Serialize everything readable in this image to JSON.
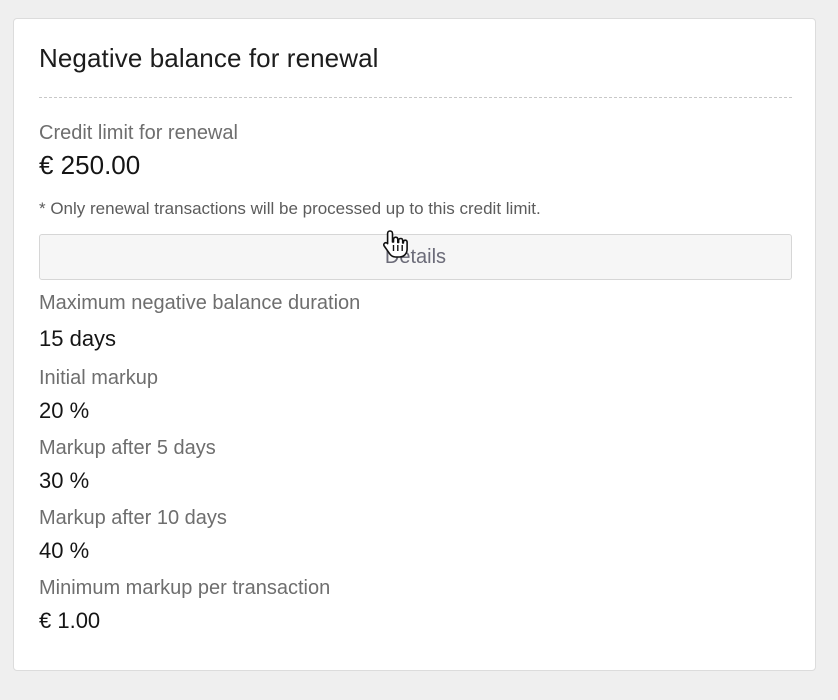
{
  "card": {
    "title": "Negative balance for renewal",
    "credit_limit_label": "Credit limit for renewal",
    "credit_limit_value": "€ 250.00",
    "note": "* Only renewal transactions will be processed up to this credit limit.",
    "details_button_label": "Details",
    "max_duration_label": "Maximum negative balance duration",
    "max_duration_value": "15 days",
    "initial_markup_label": "Initial markup",
    "initial_markup_value": "20 %",
    "markup_5_label": "Markup after 5 days",
    "markup_5_value": "30 %",
    "markup_10_label": "Markup after 10 days",
    "markup_10_value": "40 %",
    "min_markup_label": "Minimum markup per transaction",
    "min_markup_value": "€ 1.00"
  },
  "cursor": {
    "icon": "hand-pointer-icon"
  }
}
